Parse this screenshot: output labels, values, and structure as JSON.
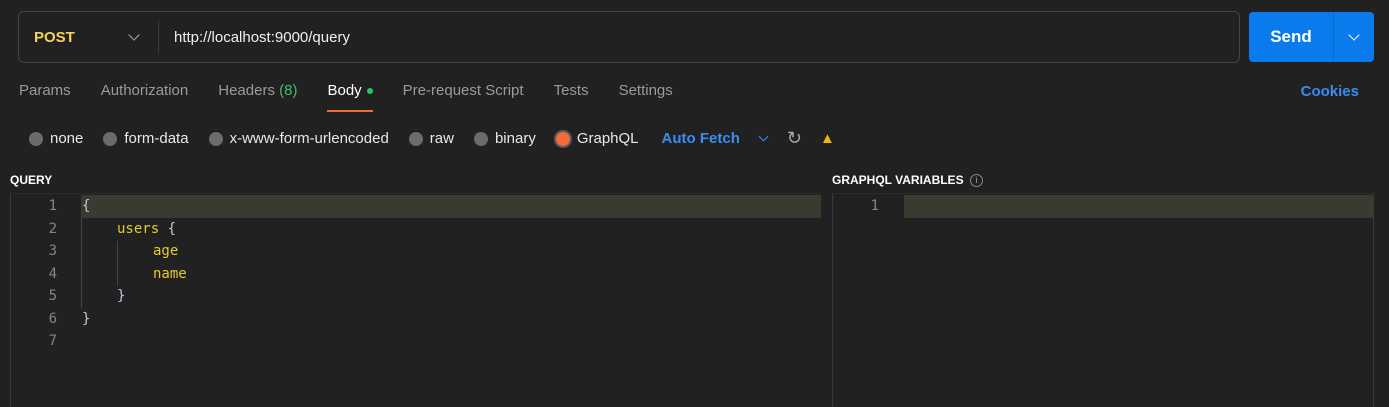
{
  "request": {
    "method": "POST",
    "url": "http://localhost:9000/query",
    "send_label": "Send"
  },
  "tabs": [
    {
      "label": "Params"
    },
    {
      "label": "Authorization"
    },
    {
      "label": "Headers",
      "count": "(8)"
    },
    {
      "label": "Body"
    },
    {
      "label": "Pre-request Script"
    },
    {
      "label": "Tests"
    },
    {
      "label": "Settings"
    }
  ],
  "cookies_label": "Cookies",
  "body_modes": [
    "none",
    "form-data",
    "x-www-form-urlencoded",
    "raw",
    "binary",
    "GraphQL"
  ],
  "auto_fetch": "Auto Fetch",
  "query": {
    "title": "QUERY",
    "line_numbers": [
      "1",
      "2",
      "3",
      "4",
      "5",
      "6",
      "7"
    ],
    "lines": [
      [
        "{"
      ],
      [
        "users",
        " {"
      ],
      [
        "age"
      ],
      [
        "name"
      ],
      [
        "}"
      ],
      [
        "}"
      ]
    ]
  },
  "variables": {
    "title": "GRAPHQL VARIABLES",
    "info": "i",
    "line_numbers": [
      "1"
    ]
  },
  "colors": {
    "accent": "#f26b3a",
    "send": "#097bed",
    "method": "#f5d35b"
  }
}
